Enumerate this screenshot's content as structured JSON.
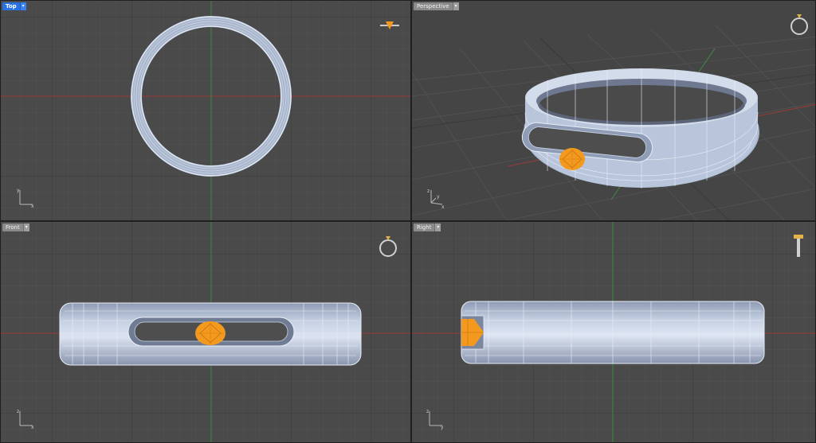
{
  "viewports": {
    "top": {
      "label": "Top",
      "active": true
    },
    "perspective": {
      "label": "Perspective",
      "active": false
    },
    "front": {
      "label": "Front",
      "active": false
    },
    "right": {
      "label": "Right",
      "active": false
    }
  },
  "menu_arrow": "▾",
  "axes": {
    "x": "x",
    "y": "y",
    "z": "z"
  },
  "colors": {
    "viewport_bg": "#4a4a4a",
    "grid_minor": "#555555",
    "grid_major": "#3c3c3c",
    "x_axis": "#9b3a3a",
    "y_axis": "#3d8a3d",
    "ring_body": "#b9c6dc",
    "ring_edge": "#e6edf8",
    "gem": "#f39a1e",
    "active_tab": "#2a72e0"
  },
  "icons": {
    "nav_widget": "ring-gizmo-icon",
    "axis_triad": "axis-triad-icon",
    "tab_menu": "chevron-down-icon"
  }
}
